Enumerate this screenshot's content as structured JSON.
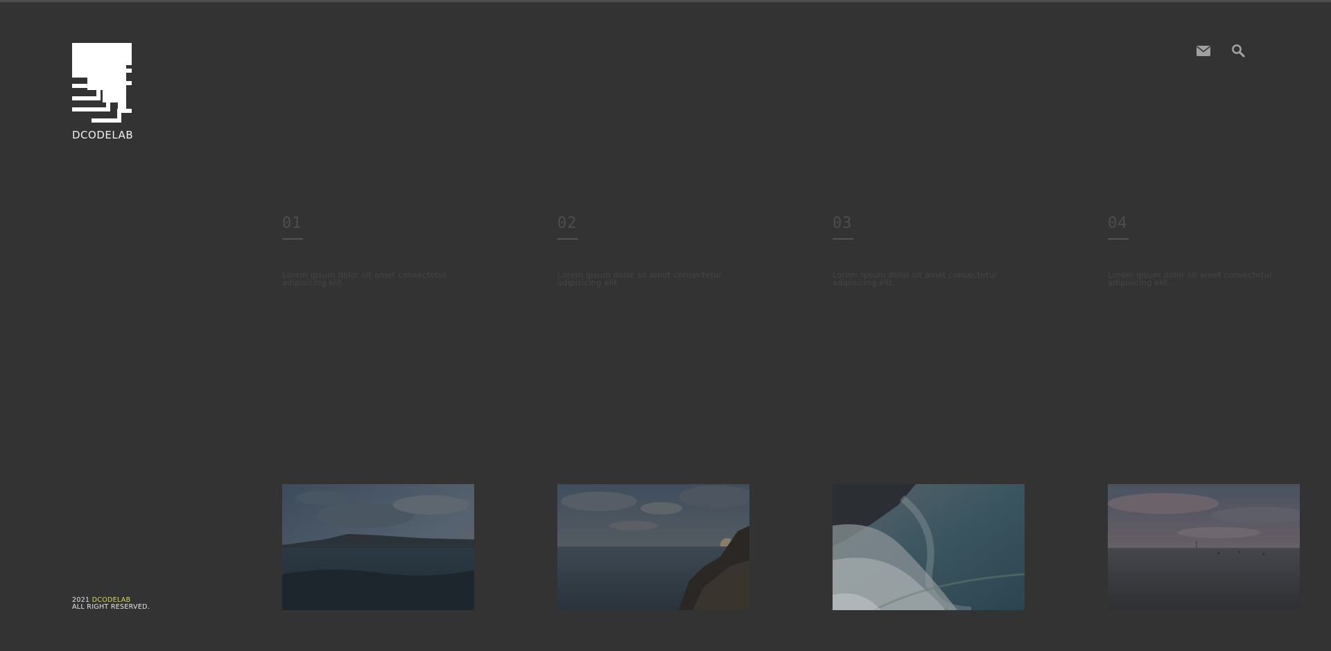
{
  "brand": {
    "logo_text": "DCODELAB"
  },
  "header": {
    "icons": [
      "envelope-icon",
      "search-icon"
    ]
  },
  "columns": [
    {
      "num": "01",
      "text": "Lorem ipsum dolor sit amet consectetur adipisicing elit."
    },
    {
      "num": "02",
      "text": "Lorem ipsum dolor sit amet consectetur adipisicing elit."
    },
    {
      "num": "03",
      "text": "Lorem ipsum dolor sit amet consectetur adipisicing elit."
    },
    {
      "num": "04",
      "text": "Lorem ipsum dolor sit amet consectetur adipisicing elit."
    }
  ],
  "footer": {
    "year": "2021",
    "brand": "DCODELAB",
    "rights": "ALL RIGHT RESERVED."
  },
  "colors": {
    "background": "#333333",
    "logo": "#ffffff",
    "footer_brand": "#d8d27a"
  }
}
